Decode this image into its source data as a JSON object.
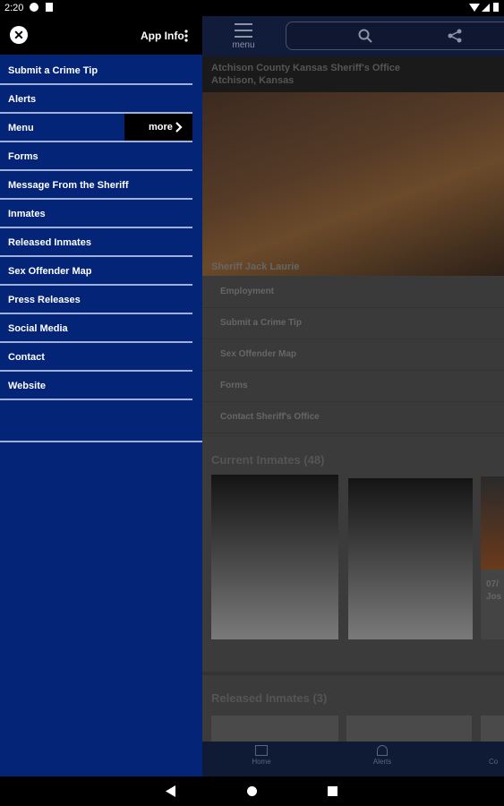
{
  "status": {
    "time": "2:20"
  },
  "drawer": {
    "app_info_label": "App Info",
    "more_label": "more",
    "items": [
      {
        "label": "Submit a Crime Tip"
      },
      {
        "label": "Alerts"
      },
      {
        "label": "Menu"
      },
      {
        "label": "Forms"
      },
      {
        "label": "Message From the Sheriff"
      },
      {
        "label": "Inmates"
      },
      {
        "label": "Released Inmates"
      },
      {
        "label": "Sex Offender Map"
      },
      {
        "label": "Press Releases"
      },
      {
        "label": "Social Media"
      },
      {
        "label": "Contact"
      },
      {
        "label": "Website"
      }
    ]
  },
  "app": {
    "menu_label": "menu",
    "office_name": "Atchison County Kansas Sheriff's Office",
    "office_location": "Atchison, Kansas",
    "hero_caption": "Sheriff Jack Laurie",
    "links": [
      "Employment",
      "Submit a Crime Tip",
      "Sex Offender Map",
      "Forms",
      "Contact Sheriff's Office"
    ],
    "current_inmates_title": "Current Inmates (48)",
    "released_inmates_title": "Released Inmates (3)",
    "partial_card_date": "07/",
    "partial_card_name": "Jos",
    "bottom_tabs": [
      "Home",
      "Alerts",
      "Co"
    ]
  },
  "colors": {
    "drawer_bg": "#042478",
    "divider": "#9fb0d8"
  }
}
